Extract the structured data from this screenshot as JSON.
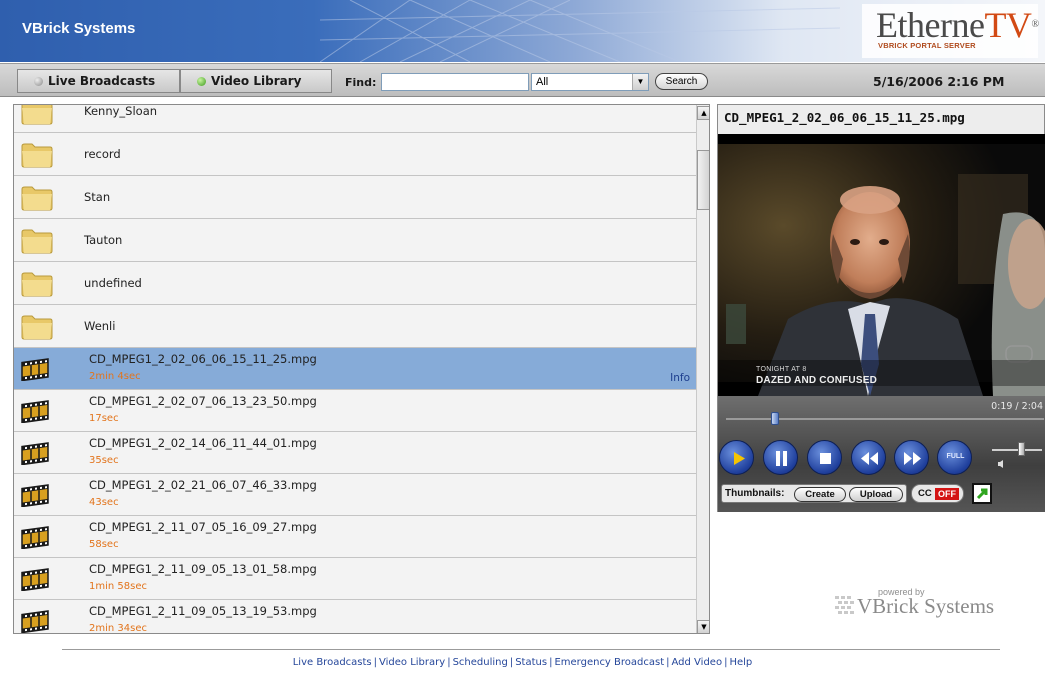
{
  "header": {
    "brand": "VBrick Systems",
    "logo_main": "Etherne",
    "logo_tv": "TV",
    "logo_mark": "®",
    "logo_sub": "VBRICK PORTAL SERVER"
  },
  "toolbar": {
    "live_tab": "Live Broadcasts",
    "video_tab": "Video Library",
    "find_label": "Find:",
    "find_value": "",
    "scope_selected": "All",
    "search_button": "Search",
    "datetime": "5/16/2006 2:16 PM"
  },
  "list": {
    "folders": [
      {
        "name": "Kenny_Sloan"
      },
      {
        "name": "record"
      },
      {
        "name": "Stan"
      },
      {
        "name": "Tauton"
      },
      {
        "name": "undefined"
      },
      {
        "name": "Wenli"
      }
    ],
    "files": [
      {
        "name": "CD_MPEG1_2_02_06_06_15_11_25.mpg",
        "duration": "2min 4sec",
        "selected": true,
        "info": "Info"
      },
      {
        "name": "CD_MPEG1_2_02_07_06_13_23_50.mpg",
        "duration": "17sec"
      },
      {
        "name": "CD_MPEG1_2_02_14_06_11_44_01.mpg",
        "duration": "35sec"
      },
      {
        "name": "CD_MPEG1_2_02_21_06_07_46_33.mpg",
        "duration": "43sec"
      },
      {
        "name": "CD_MPEG1_2_11_07_05_16_09_27.mpg",
        "duration": "58sec"
      },
      {
        "name": "CD_MPEG1_2_11_09_05_13_01_58.mpg",
        "duration": "1min 58sec"
      },
      {
        "name": "CD_MPEG1_2_11_09_05_13_19_53.mpg",
        "duration": "2min 34sec"
      }
    ]
  },
  "player": {
    "title": "CD_MPEG1_2_02_06_06_15_11_25.mpg",
    "caption_line1": "TONIGHT AT 8",
    "caption_line2": "DAZED AND CONFUSED",
    "time": "0:19 / 2:04",
    "progress_fraction": 0.153,
    "volume_fraction": 0.6,
    "full_label": "FULL",
    "thumbnails_label": "Thumbnails:",
    "create_button": "Create",
    "upload_button": "Upload",
    "cc_label": "CC",
    "cc_state": "OFF"
  },
  "powered": {
    "by": "powered by",
    "name": "VBrick Systems"
  },
  "footer": {
    "links": [
      "Live Broadcasts",
      "Video Library",
      "Scheduling",
      "Status",
      "Emergency Broadcast",
      "Add Video",
      "Help"
    ]
  },
  "colors": {
    "selected_row": "#86abd8",
    "duration_text": "#e2741c",
    "footer_link": "#26479a",
    "cc_off": "#d41414",
    "logo_tv": "#d24a14"
  },
  "icons": {
    "folder": "folder-icon",
    "video_file": "film-reel-icon"
  }
}
